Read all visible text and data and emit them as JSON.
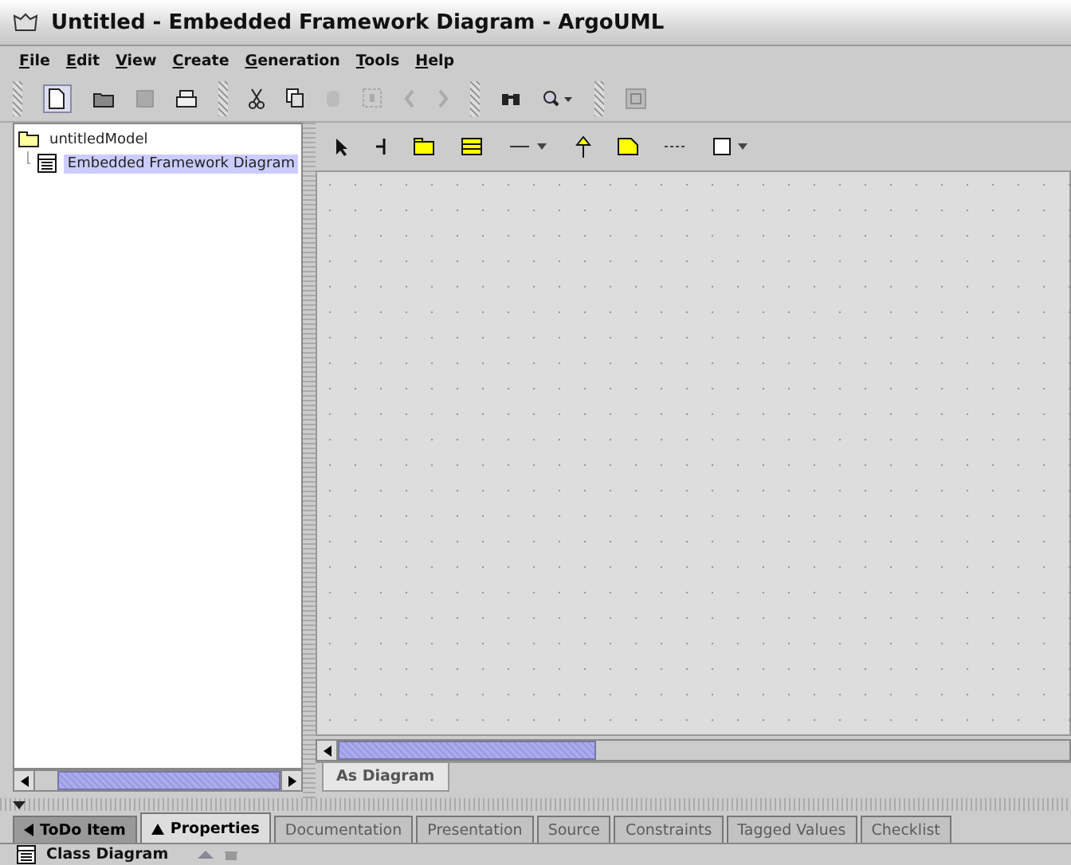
{
  "window": {
    "title": "Untitled - Embedded Framework Diagram  - ArgoUML"
  },
  "menu": [
    "File",
    "Edit",
    "View",
    "Create",
    "Generation",
    "Tools",
    "Help"
  ],
  "tree": {
    "label": "untitledModel",
    "children": [
      {
        "label": "Embedded Framework Diagram",
        "selected": true
      }
    ]
  },
  "diagram_tabs": [
    {
      "label": "As Diagram",
      "selected": true
    }
  ],
  "detail_tabs": [
    {
      "label": "ToDo Item",
      "selected": false,
      "disabled": false
    },
    {
      "label": "Properties",
      "selected": true,
      "disabled": false
    },
    {
      "label": "Documentation",
      "selected": false,
      "disabled": true
    },
    {
      "label": "Presentation",
      "selected": false,
      "disabled": true
    },
    {
      "label": "Source",
      "selected": false,
      "disabled": true
    },
    {
      "label": "Constraints",
      "selected": false,
      "disabled": true
    },
    {
      "label": "Tagged Values",
      "selected": false,
      "disabled": true
    },
    {
      "label": "Checklist",
      "selected": false,
      "disabled": true
    }
  ],
  "properties": {
    "title": "Class Diagram"
  }
}
